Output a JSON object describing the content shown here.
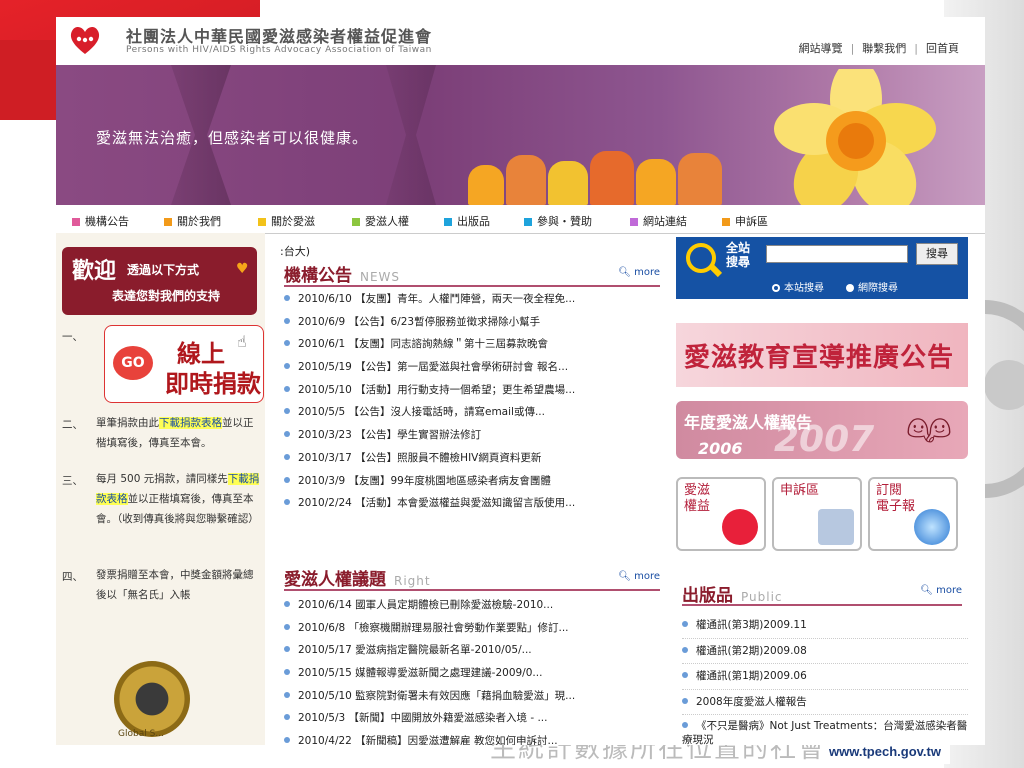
{
  "header": {
    "org_name_zh": "社團法人中華民國愛滋感染者權益促進會",
    "org_name_en": "Persons with HIV/AIDS Rights Advocacy Association of Taiwan",
    "toplinks": [
      "網站導覽",
      "聯繫我們",
      "回首頁"
    ]
  },
  "banner": {
    "slogan": "愛滋無法治癒，但感染者可以很健康。"
  },
  "nav": {
    "items": [
      {
        "label": "機構公告",
        "color": "#e05a9a"
      },
      {
        "label": "關於我們",
        "color": "#f29a1a"
      },
      {
        "label": "關於愛滋",
        "color": "#f2c21a"
      },
      {
        "label": "愛滋人權",
        "color": "#8cc63f"
      },
      {
        "label": "出版品",
        "color": "#1ea3dc"
      },
      {
        "label": "參與・贊助",
        "color": "#1ea3dc"
      },
      {
        "label": "網站連結",
        "color": "#c06ad8"
      },
      {
        "label": "申訴區",
        "color": "#f29a1a"
      }
    ]
  },
  "left": {
    "welcome_big": "歡迎",
    "welcome_line1": "透過以下方式",
    "welcome_line2": "表達您對我們的支持",
    "step1_num": "一、",
    "donate_go": "GO",
    "donate_line1": "線上",
    "donate_line2": "即時捐款",
    "step2_num": "二、",
    "step2_a": "單筆捐款由此",
    "step2_link": "下載捐款表格",
    "step2_b": "並以正楷填寫後，傳真至本會。",
    "step3_num": "三、",
    "step3_a": "每月 500 元捐款，請同樣先",
    "step3_link": "下載捐款表格",
    "step3_b": "並以正楷填寫後，傳真至本會。（收到傳真後將與您聯繫確認）",
    "step4_num": "四、",
    "step4_text": "發票捐贈至本會，中獎金額將彙總後以「無名氏」入帳",
    "seal_text": "Global S..."
  },
  "middle": {
    "crumb": ":台大)",
    "news_title": "機構公告",
    "news_title_en": "NEWS",
    "news_more": "more",
    "news": [
      "2010/6/10 【友團】青年。人權鬥陣營，兩天一夜全程免...",
      "2010/6/9 【公告】6/23暫停服務並徵求掃除小幫手",
      "2010/6/1 【友團】同志諮詢熱線＂第十三屆募款晚會",
      "2010/5/19 【公告】第一屆愛滋與社會學術研討會 報名...",
      "2010/5/10 【活動】用行動支持一個希望；更生希望農場...",
      "2010/5/5 【公告】沒人接電話時，請寫email或傳...",
      "2010/3/23 【公告】學生實習辦法修訂",
      "2010/3/17 【公告】照服員不體檢HIV網頁資料更新",
      "2010/3/9 【友團】99年度桃園地區感染者病友會團體",
      "2010/2/24 【活動】本會愛滋權益與愛滋知識留言版使用..."
    ],
    "rights_title": "愛滋人權議題",
    "rights_title_en": "Right",
    "rights_more": "more",
    "rights": [
      "2010/6/14 國軍人員定期體檢已刪除愛滋檢驗-2010...",
      "2010/6/8 「檢察機關辦理易服社會勞動作業要點」修訂...",
      "2010/5/17 愛滋病指定醫院最新名單-2010/05/...",
      "2010/5/15 媒體報導愛滋新聞之處理建議-2009/0...",
      "2010/5/10 監察院對衛署未有效因應「藉捐血驗愛滋」現...",
      "2010/5/3 【新聞】中國開放外籍愛滋感染者入境 - ...",
      "2010/4/22 【新聞稿】因愛滋遭解雇 教您如何申訴討..."
    ]
  },
  "right": {
    "search_label_1": "全站",
    "search_label_2": "搜尋",
    "search_button": "搜尋",
    "search_value": "",
    "opt_site": "本站搜尋",
    "opt_web": "網際搜尋",
    "banner1": "愛滋教育宣導推廣公告",
    "banner2_title": "年度愛滋人權報告",
    "banner2_year1": "2006",
    "banner2_year2": "2007",
    "tile1": [
      "愛滋",
      "權益"
    ],
    "tile2": [
      "申訴區"
    ],
    "tile3": [
      "訂閱",
      "電子報"
    ],
    "pub_title": "出版品",
    "pub_title_en": "Public",
    "pub_more": "more",
    "publications": [
      "權通訊(第3期)2009.11",
      "權通訊(第2期)2009.08",
      "權通訊(第1期)2009.06",
      "2008年度愛滋人權報告",
      "《不只是醫病》Not Just Treatments：台灣愛滋感染者醫療現況"
    ]
  },
  "slide": {
    "bottom_text": "生統計數據所在位置的社會",
    "url": "www.tpech.gov.tw"
  }
}
